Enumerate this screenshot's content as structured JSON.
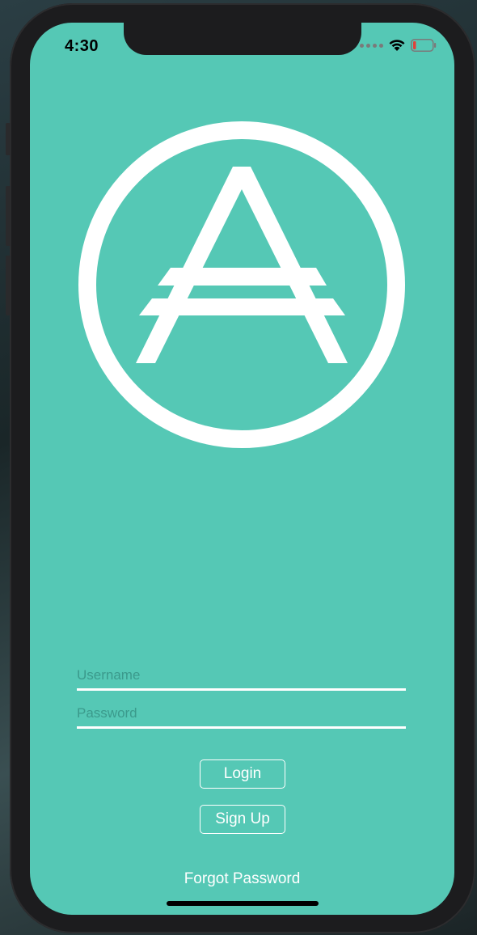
{
  "status_bar": {
    "time": "4:30",
    "icons": [
      "cellular-dots-icon",
      "wifi-icon",
      "battery-low-icon"
    ]
  },
  "logo": {
    "icon": "circled-a-logo-icon"
  },
  "form": {
    "username_placeholder": "Username",
    "username_value": "",
    "password_placeholder": "Password",
    "password_value": ""
  },
  "actions": {
    "login_label": "Login",
    "signup_label": "Sign Up",
    "forgot_label": "Forgot Password"
  },
  "colors": {
    "background": "#55c8b5",
    "foreground": "#ffffff",
    "placeholder": "#3b9a8c",
    "battery_low": "#e0423a"
  }
}
